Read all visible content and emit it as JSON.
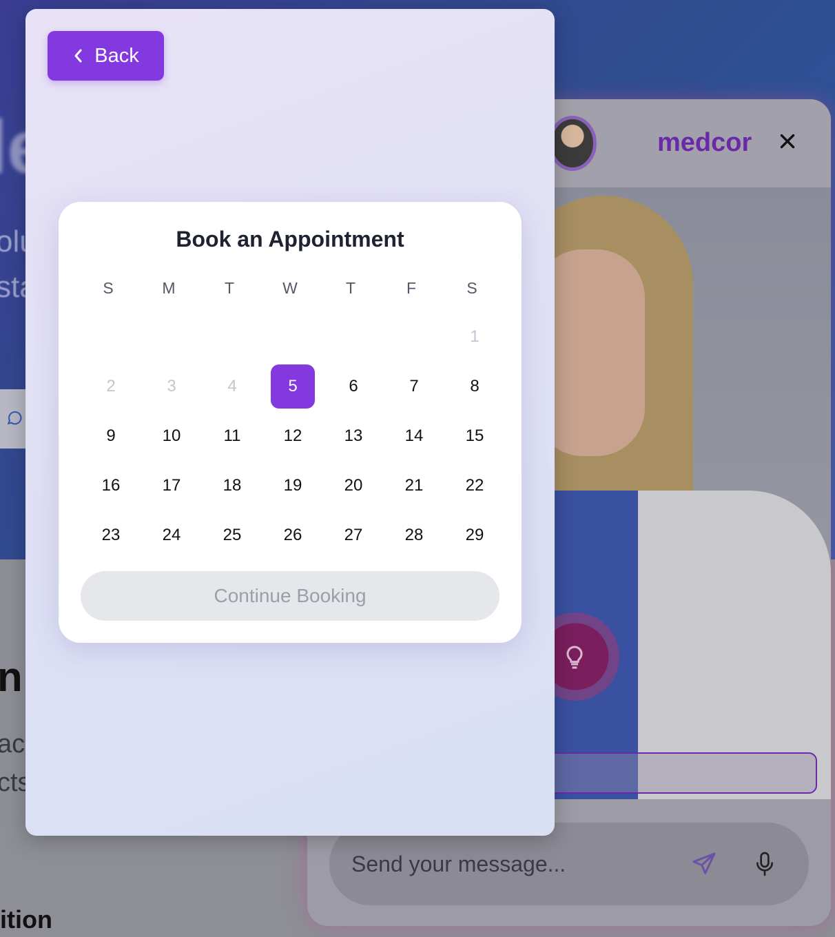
{
  "background": {
    "hero_title": "le",
    "hero_sub_lines": [
      "olu",
      "sta"
    ],
    "section_heading": "n",
    "section_text_lines": [
      "ac",
      "cts"
    ],
    "footer_heading": "ition"
  },
  "chat": {
    "brand": "medcor",
    "input_placeholder": "Send your message...",
    "colors": {
      "brand": "#6a2aa8"
    }
  },
  "modal": {
    "back_label": "Back",
    "calendar": {
      "title": "Book an Appointment",
      "weekdays": [
        "S",
        "M",
        "T",
        "W",
        "T",
        "F",
        "S"
      ],
      "leading_blanks": 6,
      "days": [
        1,
        2,
        3,
        4,
        5,
        6,
        7,
        8,
        9,
        10,
        11,
        12,
        13,
        14,
        15,
        16,
        17,
        18,
        19,
        20,
        21,
        22,
        23,
        24,
        25,
        26,
        27,
        28,
        29
      ],
      "disabled_days": [
        1,
        2,
        3,
        4
      ],
      "selected_day": 5,
      "continue_label": "Continue Booking"
    },
    "colors": {
      "accent": "#8338e0",
      "disabled_button": "#e5e7eb"
    }
  }
}
